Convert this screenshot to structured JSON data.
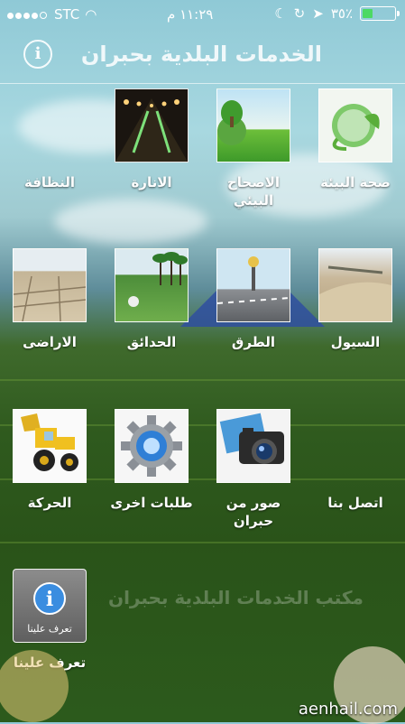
{
  "status_bar": {
    "carrier": "STC",
    "time": "١١:٢٩ م",
    "battery": "٣٥٪",
    "battery_level": 0.35
  },
  "header": {
    "title": "الخدمات البلدية بحبران"
  },
  "tiles": [
    {
      "label": "صحة البيئة",
      "icon": "globe-leaves-icon"
    },
    {
      "label": "الاصحاح البيئي",
      "icon": "earth-tree-icon"
    },
    {
      "label": "الانارة",
      "icon": "street-lights-icon"
    },
    {
      "label": "النظافة",
      "icon": "cleaning-icon"
    },
    {
      "label": "السيول",
      "icon": "flood-channel-icon"
    },
    {
      "label": "الطرق",
      "icon": "road-icon"
    },
    {
      "label": "الحدائق",
      "icon": "garden-icon"
    },
    {
      "label": "الاراضى",
      "icon": "land-icon"
    },
    {
      "label": "اتصل بنا",
      "icon": "contact-icon"
    },
    {
      "label": "صور من حبران",
      "icon": "camera-photos-icon"
    },
    {
      "label": "طلبات اخرى",
      "icon": "gear-icon"
    },
    {
      "label": "الحركة",
      "icon": "bulldozer-icon"
    },
    {
      "label": "تعرف علينا",
      "icon": "info-icon",
      "badge": "تعرف علينا"
    }
  ],
  "background_text": "مكتب الخدمات البلدية بحبران",
  "footer": {
    "site": "aenhail.com"
  }
}
